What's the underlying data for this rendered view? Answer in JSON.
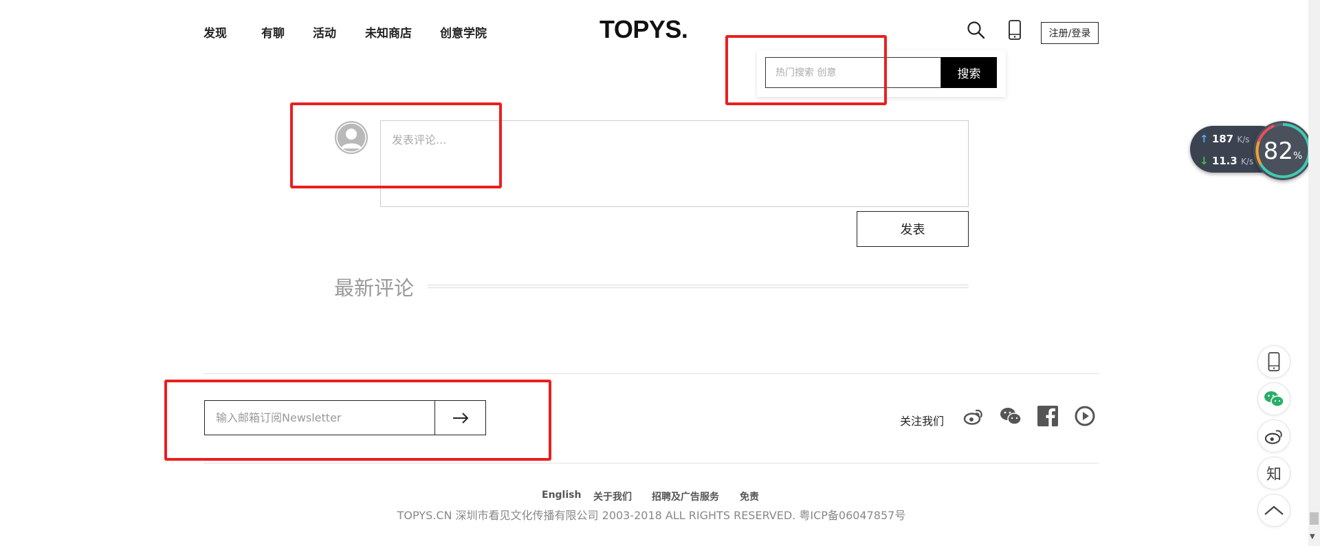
{
  "header": {
    "nav": [
      "发现",
      "有聊",
      "活动",
      "未知商店",
      "创意学院"
    ],
    "logo": "TOPYS.",
    "login_label": "注册/登录"
  },
  "search": {
    "placeholder": "热门搜索 创意",
    "button_label": "搜索"
  },
  "comment": {
    "placeholder": "发表评论...",
    "submit_label": "发表",
    "latest_title": "最新评论"
  },
  "newsletter": {
    "placeholder": "输入邮箱订阅Newsletter"
  },
  "follow": {
    "label": "关注我们",
    "icons": [
      "weibo-icon",
      "wechat-icon",
      "facebook-icon",
      "video-play-icon"
    ]
  },
  "footer": {
    "links": [
      "English",
      "关于我们",
      "招聘及广告服务",
      "免责"
    ],
    "copyright": "TOPYS.CN 深圳市看见文化传播有限公司 2003-2018 ALL RIGHTS RESERVED. 粤ICP备06047857号"
  },
  "speed_widget": {
    "upload_value": "187",
    "download_value": "11.3",
    "unit": "K/s",
    "cpu_value": "82",
    "cpu_unit": "%"
  },
  "float_toolbar": {
    "zhihu_label": "知"
  },
  "colors": {
    "annotation_red": "#ea1f1f",
    "search_button_bg": "#000000"
  }
}
